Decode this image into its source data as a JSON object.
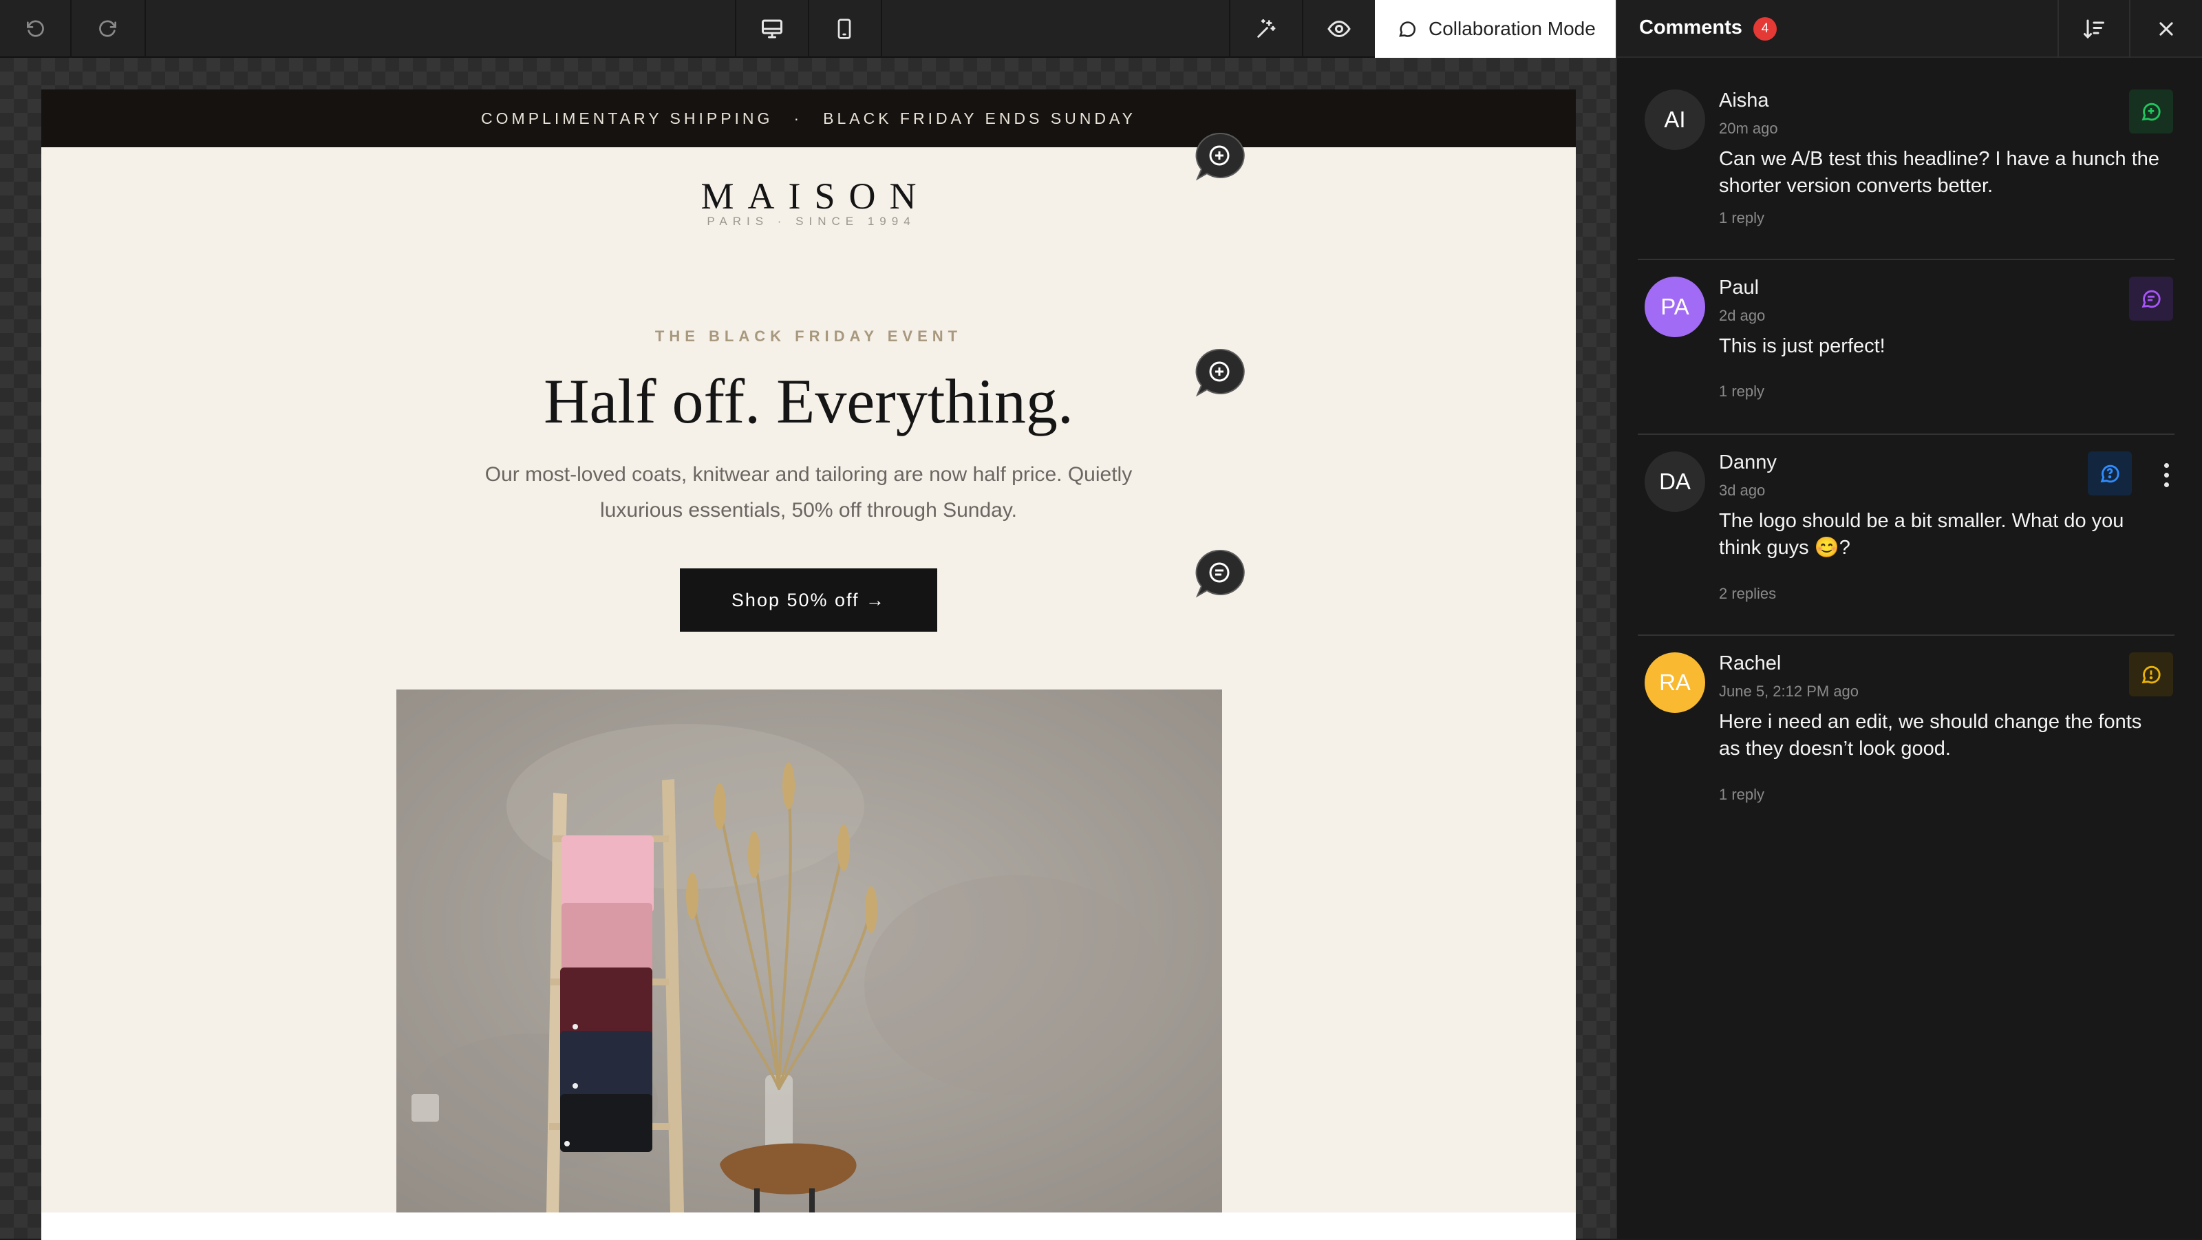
{
  "toolbar": {
    "collab_label": "Collaboration Mode",
    "icons": [
      "undo-icon",
      "redo-icon",
      "desktop-icon",
      "mobile-icon",
      "magic-icon",
      "eye-icon",
      "comment-icon"
    ]
  },
  "email": {
    "announcement_left": "COMPLIMENTARY SHIPPING",
    "announcement_sep": "·",
    "announcement_right": "BLACK FRIDAY ENDS SUNDAY",
    "brand": "MAISON",
    "brand_sub": "PARIS · SINCE 1994",
    "eyebrow": "THE BLACK FRIDAY EVENT",
    "headline": "Half off. Everything.",
    "body": "Our most-loved coats, knitwear and tailoring are now half price. Quietly luxurious essentials, 50% off through Sunday.",
    "cta": "Shop 50% off →"
  },
  "comments_panel": {
    "title": "Comments",
    "count": "4",
    "comments": [
      {
        "initials": "AI",
        "name": "Aisha",
        "time": "20m ago",
        "text": "Can we A/B test this headline? I have a hunch the shorter version converts better.",
        "replies": "1 reply",
        "avatar_color": "#2b2b2b",
        "icon_color": "#22c55e",
        "icon": "message-plus-icon"
      },
      {
        "initials": "PA",
        "name": "Paul",
        "time": "2d ago",
        "text": "This is just perfect!",
        "replies": "1 reply",
        "avatar_color": "#a26bf5",
        "icon_color": "#a855f7",
        "icon": "message-lines-icon"
      },
      {
        "initials": "DA",
        "name": "Danny",
        "time": "3d ago",
        "text": "The logo should be a bit smaller. What do you think guys 😊?",
        "replies": "2 replies",
        "avatar_color": "#2b2b2b",
        "icon_color": "#2f8cff",
        "icon": "message-question-icon"
      },
      {
        "initials": "RA",
        "name": "Rachel",
        "time": "June 5, 2:12 PM ago",
        "text": "Here i need an edit, we should change the fonts as they doesn’t look good.",
        "replies": "1 reply",
        "avatar_color": "#f9b930",
        "icon_color": "#eab308",
        "icon": "message-alert-icon"
      }
    ]
  }
}
